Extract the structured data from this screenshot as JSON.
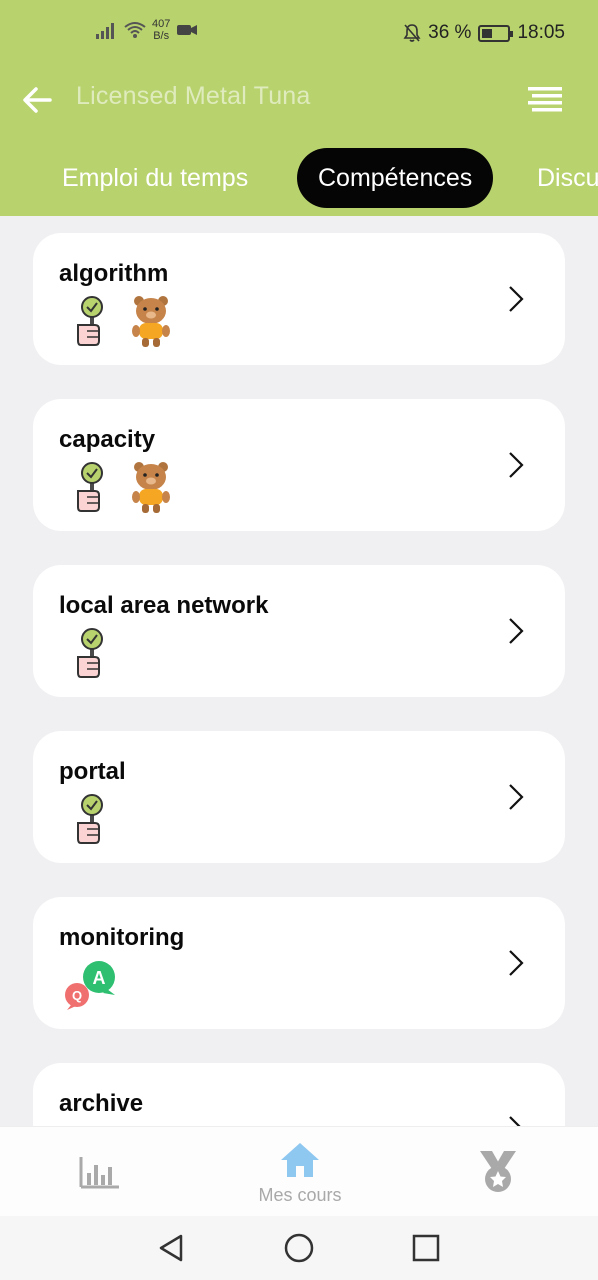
{
  "status_bar": {
    "net_speed_value": "407",
    "net_speed_unit": "B/s",
    "battery": "36 %",
    "battery_level": 0.36,
    "time": "18:05"
  },
  "header": {
    "title": "Licensed Metal Tuna",
    "icons": [
      "back-arrow-icon",
      "menu-icon"
    ]
  },
  "tabs": [
    {
      "label": "Emploi du temps",
      "active": false
    },
    {
      "label": "Compétences",
      "active": true
    },
    {
      "label": "Discu",
      "active": false
    }
  ],
  "skills": [
    {
      "name": "algorithm",
      "icons": [
        "hand-check-icon",
        "bear-icon"
      ]
    },
    {
      "name": "capacity",
      "icons": [
        "hand-check-icon",
        "bear-icon"
      ]
    },
    {
      "name": "local area network",
      "icons": [
        "hand-check-icon"
      ]
    },
    {
      "name": "portal",
      "icons": [
        "hand-check-icon"
      ]
    },
    {
      "name": "monitoring",
      "icons": [
        "qa-bubbles-icon"
      ]
    },
    {
      "name": "archive",
      "icons": []
    }
  ],
  "bottom_nav": {
    "items": [
      {
        "icon": "bar-chart-icon",
        "label": ""
      },
      {
        "icon": "home-icon",
        "label": "Mes cours",
        "active": true
      },
      {
        "icon": "medal-icon",
        "label": ""
      }
    ]
  },
  "colors": {
    "header_bg": "#b8d36e",
    "active_tab_bg": "#050505",
    "page_bg": "#f0eff1",
    "home_active": "#8ec7f0"
  }
}
